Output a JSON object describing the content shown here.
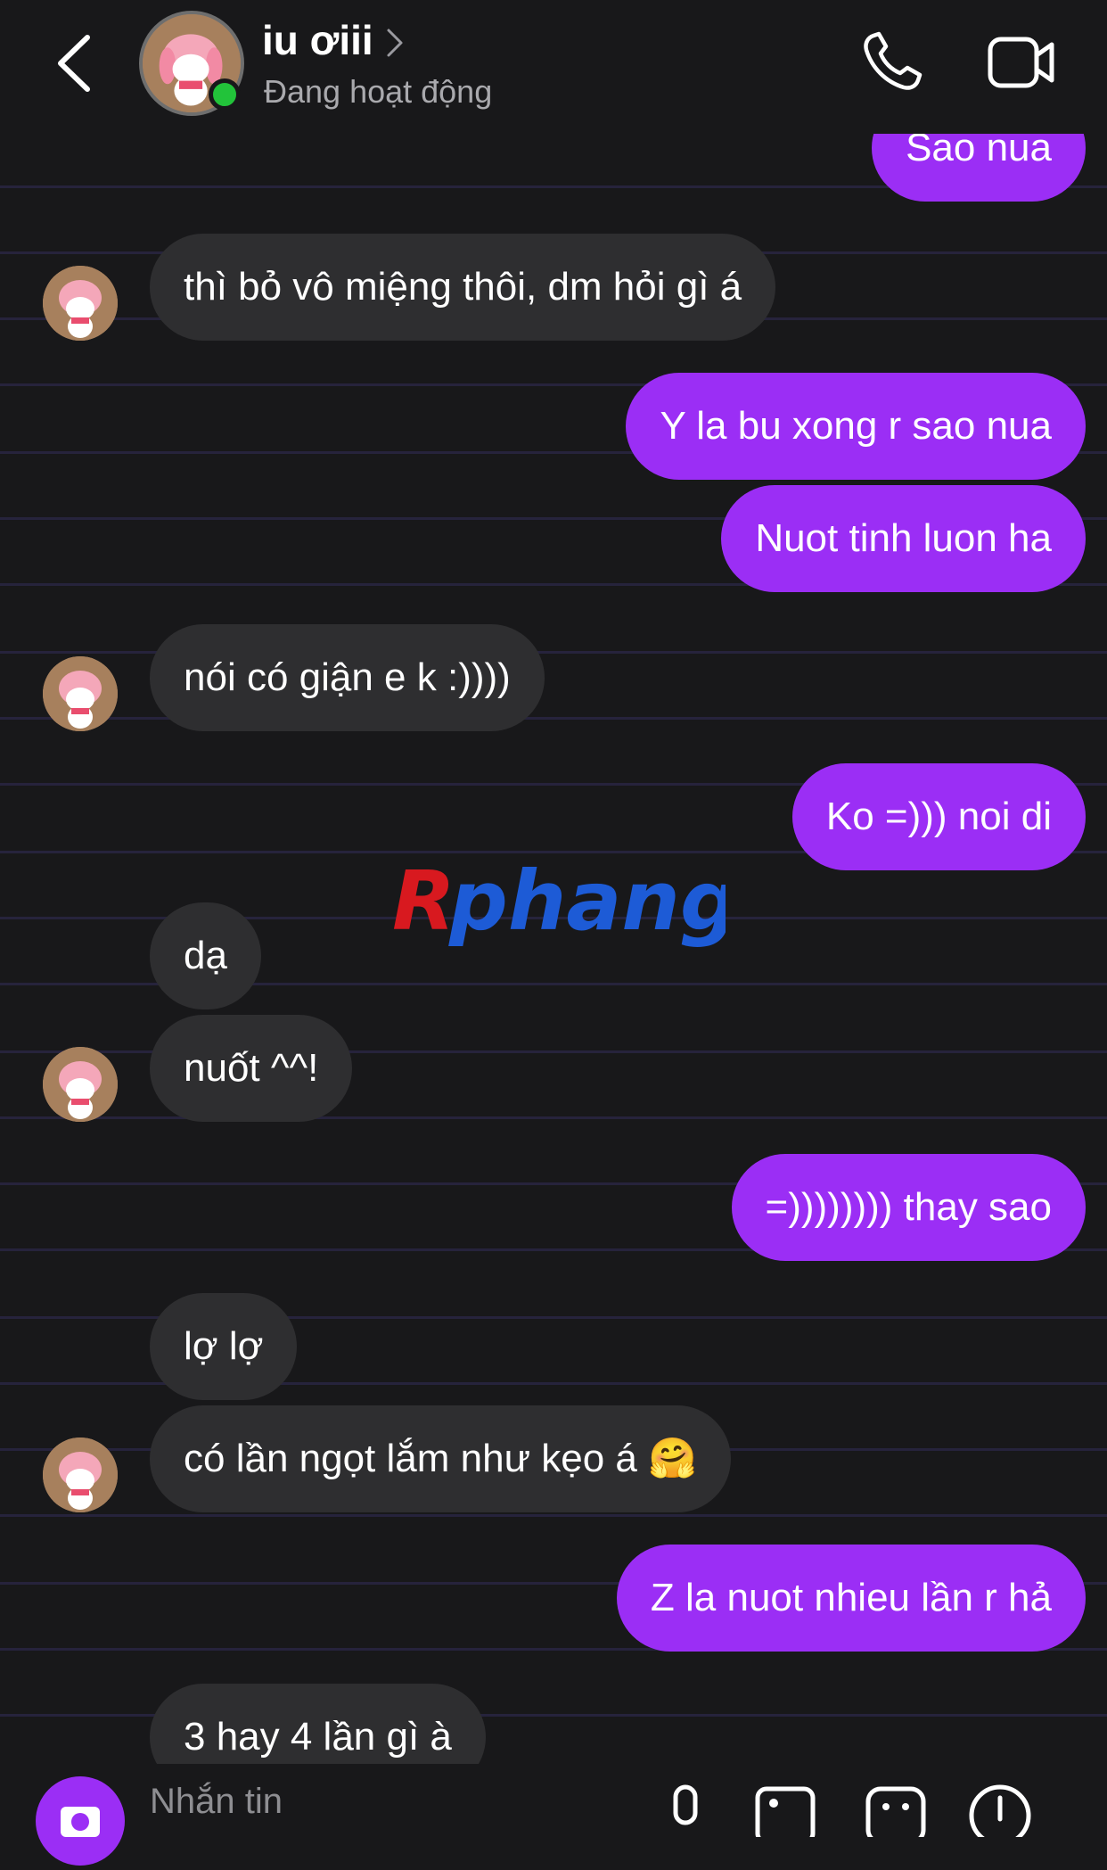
{
  "header": {
    "name": "iu ơiii",
    "status": "Đang hoạt động",
    "icons": {
      "back": "chevron-left-icon",
      "call": "phone-icon",
      "video": "video-camera-icon",
      "chevron": "chevron-right-icon"
    }
  },
  "messages": [
    {
      "dir": "out",
      "text": "Sao nua"
    },
    {
      "dir": "in",
      "text": "thì bỏ vô miệng thôi, dm hỏi gì á"
    },
    {
      "dir": "out",
      "text": "Y la bu xong r sao nua"
    },
    {
      "dir": "out",
      "text": "Nuot tinh luon ha"
    },
    {
      "dir": "in",
      "text": "nói có giận e k :))))"
    },
    {
      "dir": "out",
      "text": "Ko =))) noi di"
    },
    {
      "dir": "in",
      "text": "dạ"
    },
    {
      "dir": "in",
      "text": "nuốt ^^!"
    },
    {
      "dir": "out",
      "text": "=)))))))) thay sao"
    },
    {
      "dir": "in",
      "text": "lợ lợ"
    },
    {
      "dir": "in",
      "text": "có lần ngọt lắm như kẹo á 🤗"
    },
    {
      "dir": "out",
      "text": "Z la nuot nhieu lần r hả"
    },
    {
      "dir": "in",
      "text": "3 hay 4 lần gì à"
    }
  ],
  "watermark": "Rphang",
  "composer": {
    "placeholder": "Nhắn tin",
    "icons": [
      "camera-icon",
      "microphone-icon",
      "image-icon",
      "sticker-icon",
      "add-icon"
    ]
  },
  "colors": {
    "background": "#18181a",
    "outgoing_bubble": "#9b2ef5",
    "incoming_bubble": "#2e2e30",
    "online": "#22c33a"
  }
}
